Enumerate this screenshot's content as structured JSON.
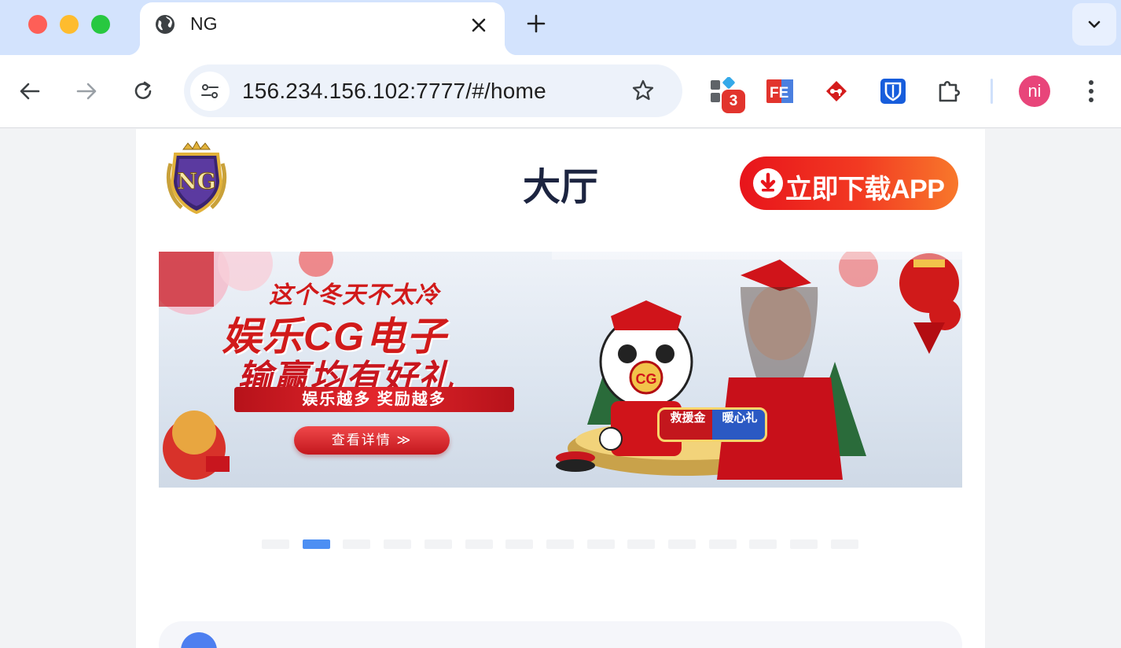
{
  "browser": {
    "tab": {
      "title": "NG",
      "favicon": "globe-icon"
    },
    "new_tab_icon": "plus-icon",
    "tab_menu_icon": "chevron-down-icon",
    "nav": {
      "back": "arrow-left-icon",
      "forward": "arrow-right-icon",
      "reload": "reload-icon"
    },
    "omnibox": {
      "url": "156.234.156.102:7777/#/home",
      "site_info_icon": "tune-icon",
      "bookmark_icon": "star-icon"
    },
    "extensions": [
      {
        "name": "extension-apps",
        "badge": "3"
      },
      {
        "name": "extension-fe"
      },
      {
        "name": "extension-git"
      },
      {
        "name": "extension-bitwarden"
      },
      {
        "name": "extensions-puzzle"
      }
    ],
    "profile": {
      "initials": "ni",
      "color": "#e8457a"
    },
    "menu_icon": "kebab-menu-icon"
  },
  "page": {
    "logo": {
      "text": "NG"
    },
    "title": "大厅",
    "download_button": {
      "label": "立即下载APP",
      "icon": "download-icon"
    },
    "banner": {
      "headline": "这个冬天不太冷",
      "line1": "娱乐CG电子",
      "line2": "输赢均有好礼",
      "strip": "娱乐越多 奖励越多",
      "cta": "查看详情 ≫",
      "badge_left": "救援金",
      "badge_right": "暖心礼",
      "mascot_text": "CG"
    },
    "carousel": {
      "count": 15,
      "active_index": 1
    },
    "notice": {
      "icon": "megaphone-icon"
    }
  },
  "colors": {
    "tabbar_bg": "#d3e3fd",
    "accent_blue": "#4d8ff3",
    "download_gradient_start": "#e8141b",
    "download_gradient_end": "#f8782b",
    "title_color": "#1c2440"
  }
}
